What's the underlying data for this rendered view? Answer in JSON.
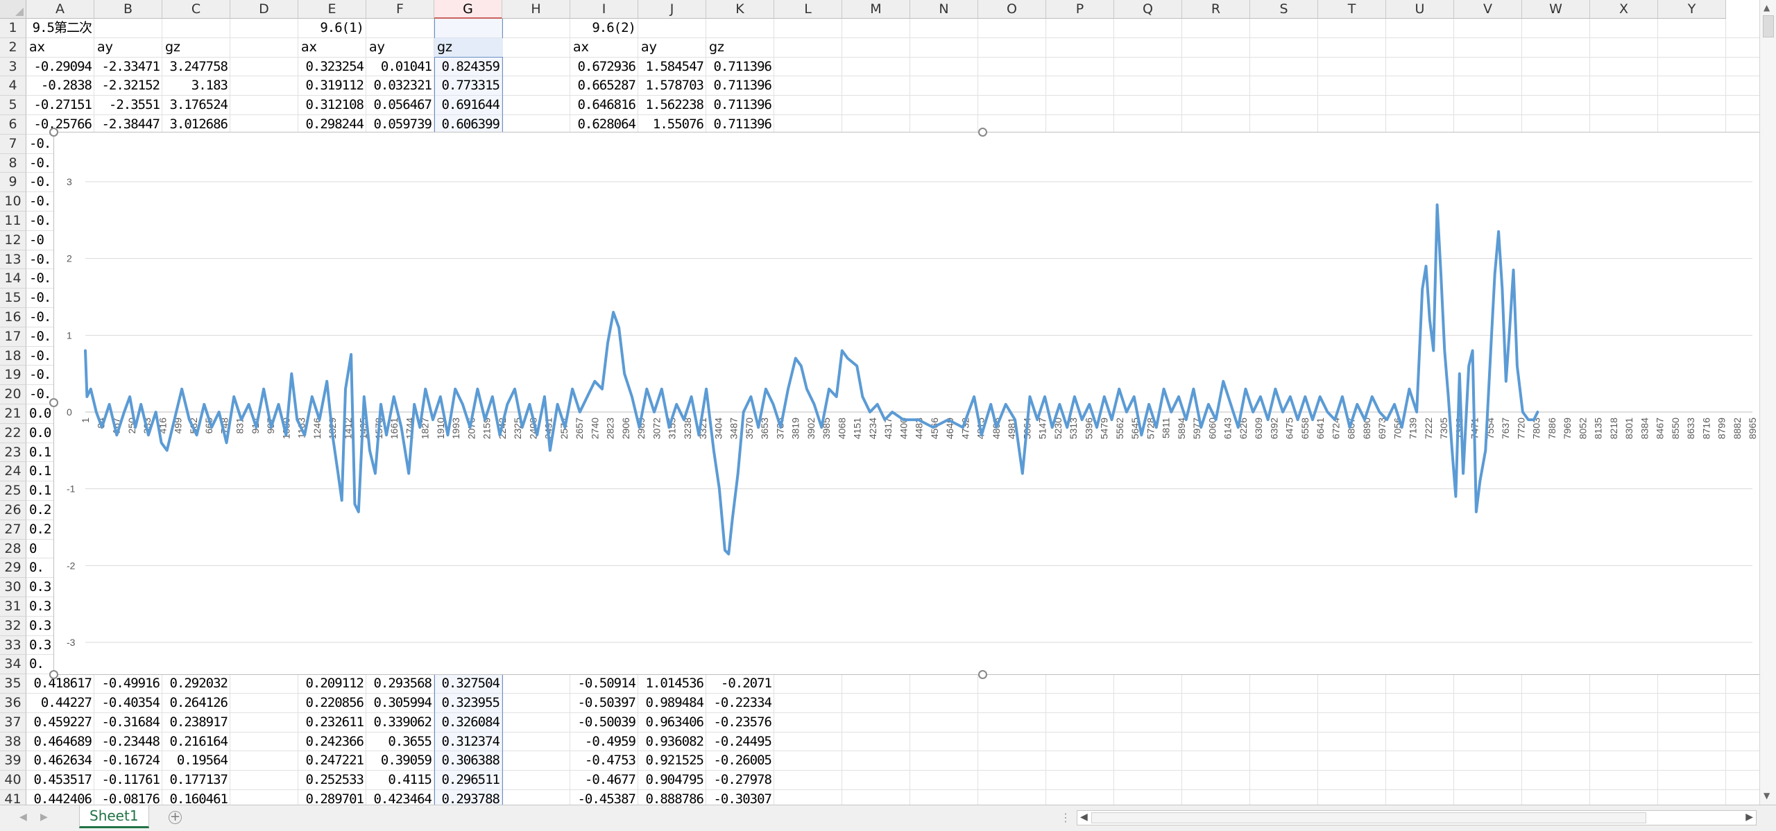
{
  "columns": [
    "A",
    "B",
    "C",
    "D",
    "E",
    "F",
    "G",
    "H",
    "I",
    "J",
    "K",
    "L",
    "M",
    "N",
    "O",
    "P",
    "Q",
    "R",
    "S",
    "T",
    "U",
    "V",
    "W",
    "X",
    "Y"
  ],
  "selected_column": "G",
  "rows_top": [
    {
      "n": "1",
      "cells": {
        "A": "9.5第二次",
        "E": "9.6(1)",
        "I": "9.6(2)"
      }
    },
    {
      "n": "2",
      "cells": {
        "A": "ax",
        "B": "ay",
        "C": "gz",
        "E": "ax",
        "F": "ay",
        "G": "gz",
        "I": "ax",
        "J": "ay",
        "K": "gz"
      }
    },
    {
      "n": "3",
      "cells": {
        "A": "-0.29094",
        "B": "-2.33471",
        "C": "3.247758",
        "E": "0.323254",
        "F": "0.01041",
        "G": "0.824359",
        "I": "0.672936",
        "J": "1.584547",
        "K": "0.711396"
      }
    },
    {
      "n": "4",
      "cells": {
        "A": "-0.2838",
        "B": "-2.32152",
        "C": "3.183",
        "E": "0.319112",
        "F": "0.032321",
        "G": "0.773315",
        "I": "0.665287",
        "J": "1.578703",
        "K": "0.711396"
      }
    },
    {
      "n": "5",
      "cells": {
        "A": "-0.27151",
        "B": "-2.3551",
        "C": "3.176524",
        "E": "0.312108",
        "F": "0.056467",
        "G": "0.691644",
        "I": "0.646816",
        "J": "1.562238",
        "K": "0.711396"
      }
    },
    {
      "n": "6",
      "cells": {
        "A": "-0.25766",
        "B": "-2.38447",
        "C": "3.012686",
        "E": "0.298244",
        "F": "0.059739",
        "G": "0.606399",
        "I": "0.628064",
        "J": "1.55076",
        "K": "0.711396"
      }
    }
  ],
  "rows_mid": [
    {
      "n": "7",
      "a": "-0."
    },
    {
      "n": "8",
      "a": "-0."
    },
    {
      "n": "9",
      "a": "-0."
    },
    {
      "n": "10",
      "a": "-0."
    },
    {
      "n": "11",
      "a": "-0."
    },
    {
      "n": "12",
      "a": "-0"
    },
    {
      "n": "13",
      "a": "-0."
    },
    {
      "n": "14",
      "a": "-0."
    },
    {
      "n": "15",
      "a": "-0."
    },
    {
      "n": "16",
      "a": "-0."
    },
    {
      "n": "17",
      "a": "-0."
    },
    {
      "n": "18",
      "a": "-0."
    },
    {
      "n": "19",
      "a": "-0."
    },
    {
      "n": "20",
      "a": "-0."
    },
    {
      "n": "21",
      "a": "0.0"
    },
    {
      "n": "22",
      "a": "0.0"
    },
    {
      "n": "23",
      "a": "0.1"
    },
    {
      "n": "24",
      "a": "0.1"
    },
    {
      "n": "25",
      "a": "0.1"
    },
    {
      "n": "26",
      "a": "0.2"
    },
    {
      "n": "27",
      "a": "0.2"
    },
    {
      "n": "28",
      "a": "0"
    },
    {
      "n": "29",
      "a": "0."
    },
    {
      "n": "30",
      "a": "0.3"
    },
    {
      "n": "31",
      "a": "0.3"
    },
    {
      "n": "32",
      "a": "0.3"
    },
    {
      "n": "33",
      "a": "0.3"
    },
    {
      "n": "34",
      "a": "0."
    }
  ],
  "rows_bottom": [
    {
      "n": "35",
      "cells": {
        "A": "0.418617",
        "B": "-0.49916",
        "C": "0.292032",
        "E": "0.209112",
        "F": "0.293568",
        "G": "0.327504",
        "I": "-0.50914",
        "J": "1.014536",
        "K": "-0.2071"
      }
    },
    {
      "n": "36",
      "cells": {
        "A": "0.44227",
        "B": "-0.40354",
        "C": "0.264126",
        "E": "0.220856",
        "F": "0.305994",
        "G": "0.323955",
        "I": "-0.50397",
        "J": "0.989484",
        "K": "-0.22334"
      }
    },
    {
      "n": "37",
      "cells": {
        "A": "0.459227",
        "B": "-0.31684",
        "C": "0.238917",
        "E": "0.232611",
        "F": "0.339062",
        "G": "0.326084",
        "I": "-0.50039",
        "J": "0.963406",
        "K": "-0.23576"
      }
    },
    {
      "n": "38",
      "cells": {
        "A": "0.464689",
        "B": "-0.23448",
        "C": "0.216164",
        "E": "0.242366",
        "F": "0.3655",
        "G": "0.312374",
        "I": "-0.4959",
        "J": "0.936082",
        "K": "-0.24495"
      }
    },
    {
      "n": "39",
      "cells": {
        "A": "0.462634",
        "B": "-0.16724",
        "C": "0.19564",
        "E": "0.247221",
        "F": "0.39059",
        "G": "0.306388",
        "I": "-0.4753",
        "J": "0.921525",
        "K": "-0.26005"
      }
    },
    {
      "n": "40",
      "cells": {
        "A": "0.453517",
        "B": "-0.11761",
        "C": "0.177137",
        "E": "0.252533",
        "F": "0.4115",
        "G": "0.296511",
        "I": "-0.4677",
        "J": "0.904795",
        "K": "-0.27978"
      }
    },
    {
      "n": "41",
      "cells": {
        "A": "0.442406",
        "B": "-0.08176",
        "C": "0.160461",
        "E": "0.289701",
        "F": "0.423464",
        "G": "0.293788",
        "I": "-0.45387",
        "J": "0.888786",
        "K": "-0.30307"
      }
    }
  ],
  "sheet_tab": "Sheet1",
  "chart_data": {
    "type": "line",
    "title": "",
    "xlabel": "",
    "ylabel": "",
    "ylim": [
      -3,
      3
    ],
    "y_ticks": [
      "3",
      "2",
      "1",
      "0",
      "-1",
      "-2",
      "-3"
    ],
    "x_ticks": [
      "1",
      "84",
      "167",
      "250",
      "333",
      "416",
      "499",
      "582",
      "665",
      "748",
      "831",
      "914",
      "997",
      "1080",
      "1163",
      "1246",
      "1329",
      "1412",
      "1495",
      "1578",
      "1661",
      "1744",
      "1827",
      "1910",
      "1993",
      "2076",
      "2159",
      "2242",
      "2325",
      "2408",
      "2491",
      "2574",
      "2657",
      "2740",
      "2823",
      "2906",
      "2989",
      "3072",
      "3155",
      "3238",
      "3321",
      "3404",
      "3487",
      "3570",
      "3653",
      "3736",
      "3819",
      "3902",
      "3985",
      "4068",
      "4151",
      "4234",
      "4317",
      "4400",
      "4483",
      "4566",
      "4649",
      "4732",
      "4815",
      "4898",
      "4981",
      "5064",
      "5147",
      "5230",
      "5313",
      "5396",
      "5479",
      "5562",
      "5645",
      "5728",
      "5811",
      "5894",
      "5977",
      "6060",
      "6143",
      "6226",
      "6309",
      "6392",
      "6475",
      "6558",
      "6641",
      "6724",
      "6807",
      "6890",
      "6973",
      "7056",
      "7139",
      "7222",
      "7305",
      "7388",
      "7471",
      "7554",
      "7637",
      "7720",
      "7803",
      "7886",
      "7969",
      "8052",
      "8135",
      "8218",
      "8301",
      "8384",
      "8467",
      "8550",
      "8633",
      "8716",
      "8799",
      "8882",
      "8965"
    ],
    "series_color": "#5b9bd5",
    "series": [
      {
        "values": [
          [
            1,
            0.8
          ],
          [
            10,
            0.2
          ],
          [
            30,
            0.3
          ],
          [
            60,
            0.0
          ],
          [
            90,
            -0.2
          ],
          [
            130,
            0.1
          ],
          [
            170,
            -0.3
          ],
          [
            210,
            0.0
          ],
          [
            240,
            0.2
          ],
          [
            270,
            -0.2
          ],
          [
            300,
            0.1
          ],
          [
            340,
            -0.3
          ],
          [
            380,
            0.0
          ],
          [
            410,
            -0.4
          ],
          [
            440,
            -0.5
          ],
          [
            470,
            -0.2
          ],
          [
            520,
            0.3
          ],
          [
            560,
            -0.1
          ],
          [
            600,
            -0.3
          ],
          [
            640,
            0.1
          ],
          [
            680,
            -0.2
          ],
          [
            720,
            0.0
          ],
          [
            760,
            -0.4
          ],
          [
            800,
            0.2
          ],
          [
            840,
            -0.1
          ],
          [
            880,
            0.1
          ],
          [
            920,
            -0.2
          ],
          [
            960,
            0.3
          ],
          [
            1000,
            -0.2
          ],
          [
            1040,
            0.1
          ],
          [
            1080,
            -0.3
          ],
          [
            1110,
            0.5
          ],
          [
            1140,
            -0.1
          ],
          [
            1180,
            -0.3
          ],
          [
            1220,
            0.2
          ],
          [
            1260,
            -0.1
          ],
          [
            1300,
            0.4
          ],
          [
            1330,
            -0.3
          ],
          [
            1360,
            -0.8
          ],
          [
            1380,
            -1.15
          ],
          [
            1400,
            0.3
          ],
          [
            1430,
            0.75
          ],
          [
            1450,
            -1.2
          ],
          [
            1470,
            -1.3
          ],
          [
            1500,
            0.2
          ],
          [
            1530,
            -0.5
          ],
          [
            1560,
            -0.8
          ],
          [
            1590,
            0.1
          ],
          [
            1620,
            -0.3
          ],
          [
            1660,
            0.2
          ],
          [
            1700,
            -0.2
          ],
          [
            1740,
            -0.8
          ],
          [
            1770,
            0.1
          ],
          [
            1800,
            -0.2
          ],
          [
            1830,
            0.3
          ],
          [
            1870,
            -0.1
          ],
          [
            1910,
            0.2
          ],
          [
            1950,
            -0.3
          ],
          [
            1990,
            0.3
          ],
          [
            2030,
            0.1
          ],
          [
            2070,
            -0.2
          ],
          [
            2110,
            0.3
          ],
          [
            2150,
            -0.1
          ],
          [
            2190,
            0.2
          ],
          [
            2230,
            -0.3
          ],
          [
            2270,
            0.1
          ],
          [
            2310,
            0.3
          ],
          [
            2350,
            -0.2
          ],
          [
            2390,
            0.1
          ],
          [
            2430,
            -0.3
          ],
          [
            2470,
            0.2
          ],
          [
            2500,
            -0.5
          ],
          [
            2540,
            0.1
          ],
          [
            2580,
            -0.2
          ],
          [
            2620,
            0.3
          ],
          [
            2660,
            0.0
          ],
          [
            2700,
            0.2
          ],
          [
            2740,
            0.4
          ],
          [
            2780,
            0.3
          ],
          [
            2810,
            0.9
          ],
          [
            2840,
            1.3
          ],
          [
            2870,
            1.1
          ],
          [
            2900,
            0.5
          ],
          [
            2940,
            0.2
          ],
          [
            2980,
            -0.2
          ],
          [
            3020,
            0.3
          ],
          [
            3060,
            0.0
          ],
          [
            3100,
            0.3
          ],
          [
            3140,
            -0.2
          ],
          [
            3180,
            0.1
          ],
          [
            3220,
            -0.1
          ],
          [
            3260,
            0.2
          ],
          [
            3300,
            -0.3
          ],
          [
            3340,
            0.3
          ],
          [
            3380,
            -0.5
          ],
          [
            3410,
            -1.0
          ],
          [
            3440,
            -1.8
          ],
          [
            3460,
            -1.85
          ],
          [
            3480,
            -1.4
          ],
          [
            3510,
            -0.8
          ],
          [
            3540,
            0.0
          ],
          [
            3580,
            0.2
          ],
          [
            3620,
            -0.2
          ],
          [
            3660,
            0.3
          ],
          [
            3700,
            0.1
          ],
          [
            3740,
            -0.2
          ],
          [
            3780,
            0.3
          ],
          [
            3820,
            0.7
          ],
          [
            3850,
            0.6
          ],
          [
            3880,
            0.3
          ],
          [
            3920,
            0.1
          ],
          [
            3960,
            -0.2
          ],
          [
            4000,
            0.3
          ],
          [
            4040,
            0.2
          ],
          [
            4070,
            0.8
          ],
          [
            4100,
            0.7
          ],
          [
            4150,
            0.6
          ],
          [
            4180,
            0.2
          ],
          [
            4220,
            0.0
          ],
          [
            4260,
            0.1
          ],
          [
            4300,
            -0.1
          ],
          [
            4340,
            0.0
          ],
          [
            4400,
            -0.1
          ],
          [
            4480,
            -0.1
          ],
          [
            4560,
            -0.2
          ],
          [
            4640,
            -0.1
          ],
          [
            4720,
            -0.2
          ],
          [
            4780,
            0.2
          ],
          [
            4820,
            -0.3
          ],
          [
            4870,
            0.1
          ],
          [
            4900,
            -0.2
          ],
          [
            4950,
            0.1
          ],
          [
            5000,
            -0.1
          ],
          [
            5040,
            -0.8
          ],
          [
            5080,
            0.2
          ],
          [
            5120,
            -0.1
          ],
          [
            5160,
            0.2
          ],
          [
            5200,
            -0.2
          ],
          [
            5240,
            0.1
          ],
          [
            5280,
            -0.2
          ],
          [
            5320,
            0.2
          ],
          [
            5360,
            -0.1
          ],
          [
            5400,
            0.1
          ],
          [
            5440,
            -0.2
          ],
          [
            5480,
            0.2
          ],
          [
            5520,
            -0.1
          ],
          [
            5560,
            0.3
          ],
          [
            5600,
            0.0
          ],
          [
            5640,
            0.2
          ],
          [
            5680,
            -0.3
          ],
          [
            5720,
            0.1
          ],
          [
            5760,
            -0.2
          ],
          [
            5800,
            0.3
          ],
          [
            5840,
            0.0
          ],
          [
            5880,
            0.2
          ],
          [
            5920,
            -0.1
          ],
          [
            5960,
            0.3
          ],
          [
            6000,
            -0.2
          ],
          [
            6040,
            0.1
          ],
          [
            6080,
            -0.1
          ],
          [
            6120,
            0.4
          ],
          [
            6160,
            0.1
          ],
          [
            6200,
            -0.2
          ],
          [
            6240,
            0.3
          ],
          [
            6280,
            0.0
          ],
          [
            6320,
            0.2
          ],
          [
            6360,
            -0.1
          ],
          [
            6400,
            0.3
          ],
          [
            6440,
            0.0
          ],
          [
            6480,
            0.2
          ],
          [
            6520,
            -0.1
          ],
          [
            6560,
            0.2
          ],
          [
            6600,
            -0.1
          ],
          [
            6640,
            0.2
          ],
          [
            6680,
            0.0
          ],
          [
            6720,
            -0.1
          ],
          [
            6760,
            0.2
          ],
          [
            6800,
            -0.2
          ],
          [
            6840,
            0.1
          ],
          [
            6880,
            -0.1
          ],
          [
            6920,
            0.2
          ],
          [
            6960,
            0.0
          ],
          [
            7000,
            -0.1
          ],
          [
            7040,
            0.1
          ],
          [
            7080,
            -0.2
          ],
          [
            7120,
            0.3
          ],
          [
            7160,
            0.0
          ],
          [
            7190,
            1.6
          ],
          [
            7210,
            1.9
          ],
          [
            7230,
            1.2
          ],
          [
            7250,
            0.8
          ],
          [
            7270,
            2.7
          ],
          [
            7290,
            1.8
          ],
          [
            7310,
            0.8
          ],
          [
            7330,
            0.2
          ],
          [
            7350,
            -0.5
          ],
          [
            7370,
            -1.1
          ],
          [
            7390,
            0.5
          ],
          [
            7410,
            -0.8
          ],
          [
            7440,
            0.6
          ],
          [
            7460,
            0.8
          ],
          [
            7480,
            -1.3
          ],
          [
            7500,
            -0.9
          ],
          [
            7530,
            -0.5
          ],
          [
            7560,
            0.9
          ],
          [
            7580,
            1.8
          ],
          [
            7600,
            2.35
          ],
          [
            7620,
            1.6
          ],
          [
            7640,
            0.4
          ],
          [
            7660,
            1.1
          ],
          [
            7680,
            1.85
          ],
          [
            7700,
            0.6
          ],
          [
            7730,
            0.0
          ],
          [
            7760,
            -0.1
          ],
          [
            7790,
            -0.1
          ],
          [
            7810,
            0.0
          ]
        ]
      }
    ]
  }
}
